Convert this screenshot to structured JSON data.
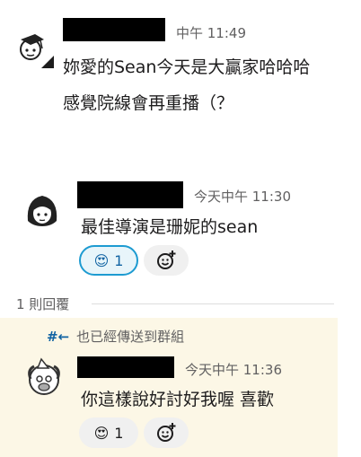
{
  "messages": [
    {
      "time": "中午 11:49",
      "lines": [
        "妳愛的Sean今天是大贏家哈哈哈",
        "感覺院線會再重播（？"
      ]
    },
    {
      "time": "今天中午 11:30",
      "lines": [
        "最佳導演是珊妮的sean"
      ],
      "reactions": [
        {
          "emoji": "😍",
          "count": "1"
        }
      ]
    }
  ],
  "thread": {
    "reply_count": "1 則回覆",
    "sent_icon": "#←",
    "sent_note": "也已經傳送到群組",
    "reply": {
      "time": "今天中午 11:36",
      "lines": [
        "你這樣說好討好我喔 喜歡"
      ],
      "reactions": [
        {
          "emoji": "😍",
          "count": "1"
        }
      ]
    }
  },
  "colors": {
    "accent": "#1d9bd1",
    "thread_bg": "#fcf7e6",
    "reaction_active_bg": "#e8f5fa"
  },
  "icons": [
    "add-reaction-icon",
    "emoji-heart-eyes-icon",
    "shared-to-channel-icon"
  ]
}
